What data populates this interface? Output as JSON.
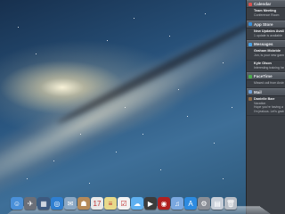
{
  "notification_center": {
    "sections": [
      {
        "key": "calendar",
        "header": "Calendar",
        "icon": "calendar-icon",
        "color": "#d9534f",
        "items": [
          {
            "title": "Team Meeting",
            "subtitle": "Conference Room"
          }
        ]
      },
      {
        "key": "app_store",
        "header": "App Store",
        "icon": "app-store-icon",
        "color": "#3a8fd8",
        "items": [
          {
            "title": "New Updates Available",
            "subtitle": "1 update is available"
          }
        ]
      },
      {
        "key": "messages",
        "header": "Messages",
        "icon": "messages-icon",
        "color": "#4aa3e8",
        "items": [
          {
            "title": "Graham Mcbride",
            "subtitle": "Jon, is your new game out"
          },
          {
            "title": "Kyle Olson",
            "subtitle": "Interesting training here"
          }
        ]
      },
      {
        "key": "facetime",
        "header": "FaceTime",
        "icon": "facetime-icon",
        "color": "#4cae4c",
        "items": [
          {
            "title": "",
            "subtitle": "Missed call from Andrew"
          }
        ]
      },
      {
        "key": "mail",
        "header": "Mail",
        "icon": "mail-icon",
        "color": "#6fa0d8",
        "items": [
          {
            "title": "Danielle Barr",
            "subtitle": "Vacation",
            "extra": "Hope you're having a great time!",
            "extra2": "I'm jealous. Let's grab lunch"
          }
        ]
      }
    ]
  },
  "dock": {
    "apps": [
      {
        "name": "finder-icon",
        "color": "#4a90d9",
        "glyph": "☺"
      },
      {
        "name": "launchpad-icon",
        "color": "#6b6f78",
        "glyph": "✈"
      },
      {
        "name": "mission-control-icon",
        "color": "#3d5a80",
        "glyph": "▦"
      },
      {
        "name": "safari-icon",
        "color": "#2f7fd1",
        "glyph": "◎"
      },
      {
        "name": "mail-dock-icon",
        "color": "#8aa7c4",
        "glyph": "✉"
      },
      {
        "name": "contacts-icon",
        "color": "#b58a5a",
        "glyph": "☗"
      },
      {
        "name": "calendar-dock-icon",
        "color": "#e8e8e8",
        "glyph": "17"
      },
      {
        "name": "notes-icon",
        "color": "#e8d98a",
        "glyph": "≡"
      },
      {
        "name": "reminders-icon",
        "color": "#f2f2f2",
        "glyph": "☑"
      },
      {
        "name": "messages-dock-icon",
        "color": "#5fb0f0",
        "glyph": "☁"
      },
      {
        "name": "facetime-dock-icon",
        "color": "#3c3c3c",
        "glyph": "▶"
      },
      {
        "name": "photo-booth-icon",
        "color": "#b02020",
        "glyph": "◉"
      },
      {
        "name": "itunes-icon",
        "color": "#7aa8e0",
        "glyph": "♫"
      },
      {
        "name": "app-store-dock-icon",
        "color": "#2d8be0",
        "glyph": "A"
      },
      {
        "name": "system-preferences-icon",
        "color": "#8a8e96",
        "glyph": "⚙"
      },
      {
        "name": "documents-icon",
        "color": "#c7ced8",
        "glyph": "▤"
      },
      {
        "name": "trash-icon",
        "color": "#b8bec6",
        "glyph": "🗑"
      }
    ]
  }
}
